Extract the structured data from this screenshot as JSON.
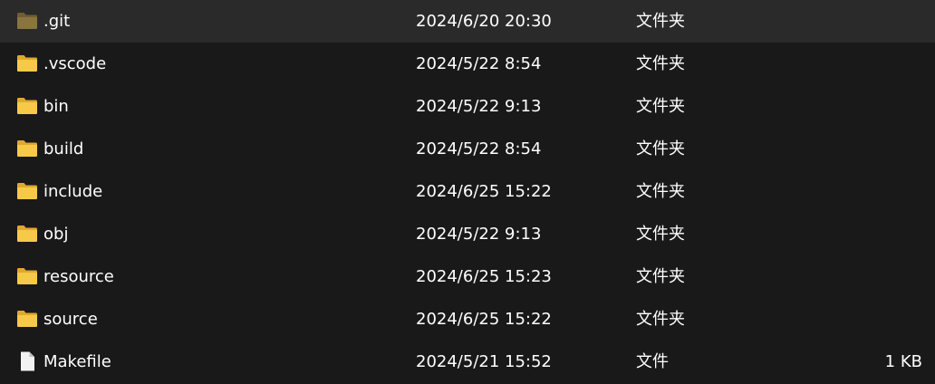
{
  "files": [
    {
      "name": ".git",
      "modified": "2024/6/20 20:30",
      "type": "文件夹",
      "size": "",
      "icon": "folder-icon-dim"
    },
    {
      "name": ".vscode",
      "modified": "2024/5/22 8:54",
      "type": "文件夹",
      "size": "",
      "icon": "folder-icon"
    },
    {
      "name": "bin",
      "modified": "2024/5/22 9:13",
      "type": "文件夹",
      "size": "",
      "icon": "folder-icon"
    },
    {
      "name": "build",
      "modified": "2024/5/22 8:54",
      "type": "文件夹",
      "size": "",
      "icon": "folder-icon"
    },
    {
      "name": "include",
      "modified": "2024/6/25 15:22",
      "type": "文件夹",
      "size": "",
      "icon": "folder-icon"
    },
    {
      "name": "obj",
      "modified": "2024/5/22 9:13",
      "type": "文件夹",
      "size": "",
      "icon": "folder-icon"
    },
    {
      "name": "resource",
      "modified": "2024/6/25 15:23",
      "type": "文件夹",
      "size": "",
      "icon": "folder-icon"
    },
    {
      "name": "source",
      "modified": "2024/6/25 15:22",
      "type": "文件夹",
      "size": "",
      "icon": "folder-icon"
    },
    {
      "name": "Makefile",
      "modified": "2024/5/21 15:52",
      "type": "文件",
      "size": "1 KB",
      "icon": "file-icon"
    }
  ],
  "colors": {
    "background": "#191919",
    "text": "#ffffff",
    "folder": "#f7c948",
    "folder_dim": "#8a7440",
    "file": "#f2f2f2"
  }
}
